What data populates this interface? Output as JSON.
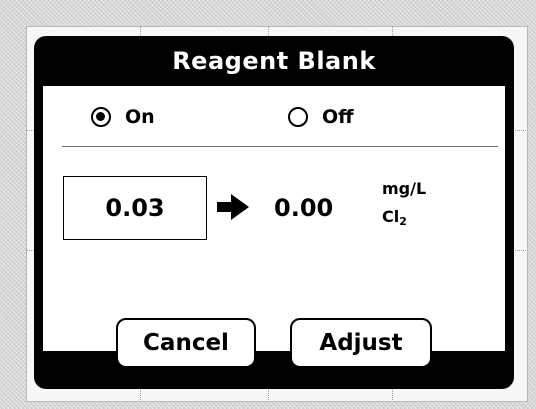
{
  "dialog": {
    "title": "Reagent Blank",
    "radio_on_label": "On",
    "radio_off_label": "Off",
    "selected": "On",
    "measured_value": "0.03",
    "result_value": "0.00",
    "unit_line1": "mg/L",
    "unit_line2_main": "Cl",
    "unit_line2_sub": "2",
    "cancel_label": "Cancel",
    "adjust_label": "Adjust"
  }
}
